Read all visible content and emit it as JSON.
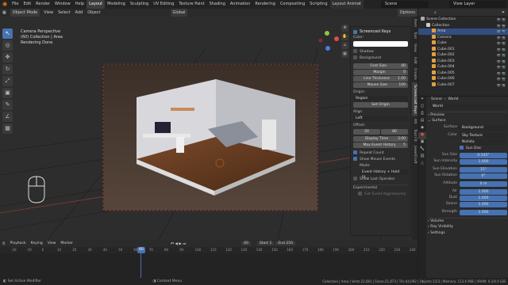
{
  "topbar": {
    "menus": [
      "File",
      "Edit",
      "Render",
      "Window",
      "Help"
    ],
    "workspaces": [
      "Layout",
      "Modeling",
      "Sculpting",
      "UV Editing",
      "Texture Paint",
      "Shading",
      "Animation",
      "Rendering",
      "Compositing",
      "Scripting",
      "Layout Animat"
    ],
    "scene": "Scene",
    "view_layer": "View Layer"
  },
  "viewport_header": {
    "mode": "Object Mode",
    "menus": [
      "View",
      "Select",
      "Add",
      "Object"
    ],
    "orientation": "Global",
    "options": "Options"
  },
  "overlay": {
    "line1": "Camera Perspective",
    "line2": "(60) Collection | Area",
    "line3": "Rendering Done"
  },
  "tools": [
    "↖",
    "◎",
    "✥",
    "↻",
    "⤢",
    "▣",
    "✎",
    "∠",
    "▦"
  ],
  "keys_panel": {
    "title": "Screencast Keys",
    "color_label": "Color:",
    "shadow": "Shadow",
    "background": "Background",
    "font_size_label": "Font Size",
    "font_size": "40",
    "margin_label": "Margin",
    "margin": "0",
    "line_thickness_label": "Line Thickness",
    "line_thickness": "1.00",
    "mouse_size_label": "Mouse Size",
    "mouse_size": "100",
    "origin_label": "Origin:",
    "origin": "Region",
    "set_origin": "Set Origin",
    "align_label": "Align",
    "align": "Left",
    "offset_label": "Offset:",
    "offset_x": "20",
    "offset_y": "80",
    "display_time_label": "Display Time",
    "display_time": "3.00",
    "max_history_label": "Max Event History",
    "max_history": "5",
    "repeat_count": "Repeat Count",
    "show_mouse": "Show Mouse Events",
    "mode_label": "Mode:",
    "mode": "Event History + Hold St...",
    "show_last": "Show Last Operator",
    "experimental": "Experimental",
    "get_event": "Get Event Aggressively"
  },
  "side_tabs": [
    "Item",
    "Tool",
    "View",
    "Edit",
    "Create",
    "Screencast Keys",
    "AN",
    "Tool FX",
    "JewelCraft"
  ],
  "outliner": {
    "rows": [
      {
        "label": "Scene Collection",
        "color": "#aaaaaa",
        "indent": 0
      },
      {
        "label": "Collection",
        "color": "#cccccc",
        "indent": 1
      },
      {
        "label": "Area",
        "color": "#e0a040",
        "indent": 2,
        "sel": true
      },
      {
        "label": "Camera",
        "color": "#e0a040",
        "indent": 2
      },
      {
        "label": "Cube",
        "color": "#e0a040",
        "indent": 2
      },
      {
        "label": "Cube.001",
        "color": "#e0a040",
        "indent": 2
      },
      {
        "label": "Cube.002",
        "color": "#e0a040",
        "indent": 2
      },
      {
        "label": "Cube.003",
        "color": "#e0a040",
        "indent": 2
      },
      {
        "label": "Cube.004",
        "color": "#e0a040",
        "indent": 2
      },
      {
        "label": "Cube.005",
        "color": "#e0a040",
        "indent": 2
      },
      {
        "label": "Cube.006",
        "color": "#e0a040",
        "indent": 2
      },
      {
        "label": "Cube.007",
        "color": "#e0a040",
        "indent": 2
      }
    ]
  },
  "props": {
    "crumb1": "Scene",
    "crumb2": "World",
    "world": "World",
    "preview": "Preview",
    "surface": "Surface",
    "surface_label": "Surface",
    "surface_val": "Background",
    "color_label": "Color",
    "color_val": "Sky Texture",
    "sky_type": "Nishita",
    "sun_disc": "Sun Disc",
    "sun_size_label": "Sun Size",
    "sun_size": "0.545°",
    "sun_int_label": "Sun Intensity",
    "sun_int": "1.000",
    "sun_elev_label": "Sun Elevation",
    "sun_elev": "15°",
    "sun_rot_label": "Sun Rotation",
    "sun_rot": "0°",
    "alt_label": "Altitude",
    "alt": "0 m",
    "air_label": "Air",
    "air": "1.000",
    "dust_label": "Dust",
    "dust": "1.000",
    "ozone_label": "Ozone",
    "ozone": "1.000",
    "strength_label": "Strength",
    "strength": "1.000",
    "volume": "Volume",
    "ray_vis": "Ray Visibility",
    "settings": "Settings"
  },
  "timeline": {
    "playback": "Playback",
    "keying": "Keying",
    "view": "View",
    "marker": "Marker",
    "current": "60",
    "start_label": "Start",
    "start": "1",
    "end_label": "End",
    "end": "250",
    "ticks": [
      "-20",
      "-10",
      "0",
      "10",
      "20",
      "30",
      "40",
      "50",
      "60",
      "70",
      "80",
      "90",
      "100",
      "110",
      "120",
      "130",
      "140",
      "150",
      "160",
      "170",
      "180",
      "190",
      "200",
      "210",
      "220",
      "230",
      "240"
    ]
  },
  "status": {
    "left": "Set Active Modifier",
    "mid": "Context Menu",
    "right": "Collection | Area | Verts:22,081 | Faces:21,873 | Tris:44,092 | Objects:1/23 | Memory: 113.6 MiB | VRAM: 0.2/4.0 GiB"
  }
}
